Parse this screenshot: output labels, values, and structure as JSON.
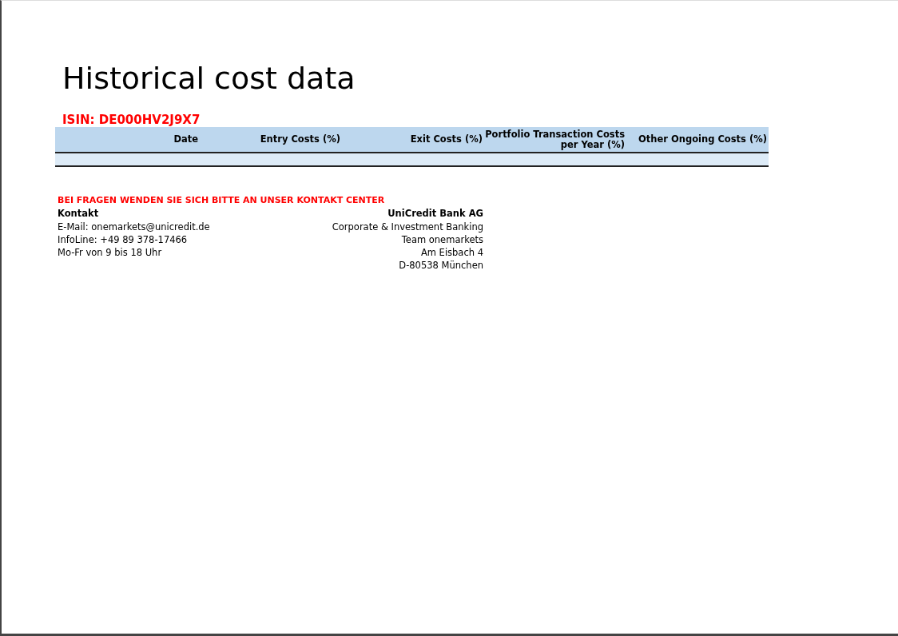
{
  "title": "Historical cost data",
  "isin": "ISIN: DE000HV2J9X7",
  "table": {
    "columns": [
      "Date",
      "Entry Costs (%)",
      "Exit Costs (%)",
      "Portfolio Transaction Costs per Year (%)",
      "Other Ongoing Costs (%)"
    ]
  },
  "contact": {
    "notice": "BEI FRAGEN WENDEN SIE SICH BITTE AN UNSER KONTAKT CENTER",
    "left": {
      "heading": "Kontakt",
      "lines": [
        "E-Mail: onemarkets@unicredit.de",
        "InfoLine: +49 89 378-17466",
        "Mo-Fr von 9 bis 18 Uhr"
      ]
    },
    "right": {
      "heading": "UniCredit Bank AG",
      "lines": [
        "Corporate & Investment Banking",
        "Team onemarkets",
        "Am Eisbach 4",
        "D-80538 München"
      ]
    }
  }
}
